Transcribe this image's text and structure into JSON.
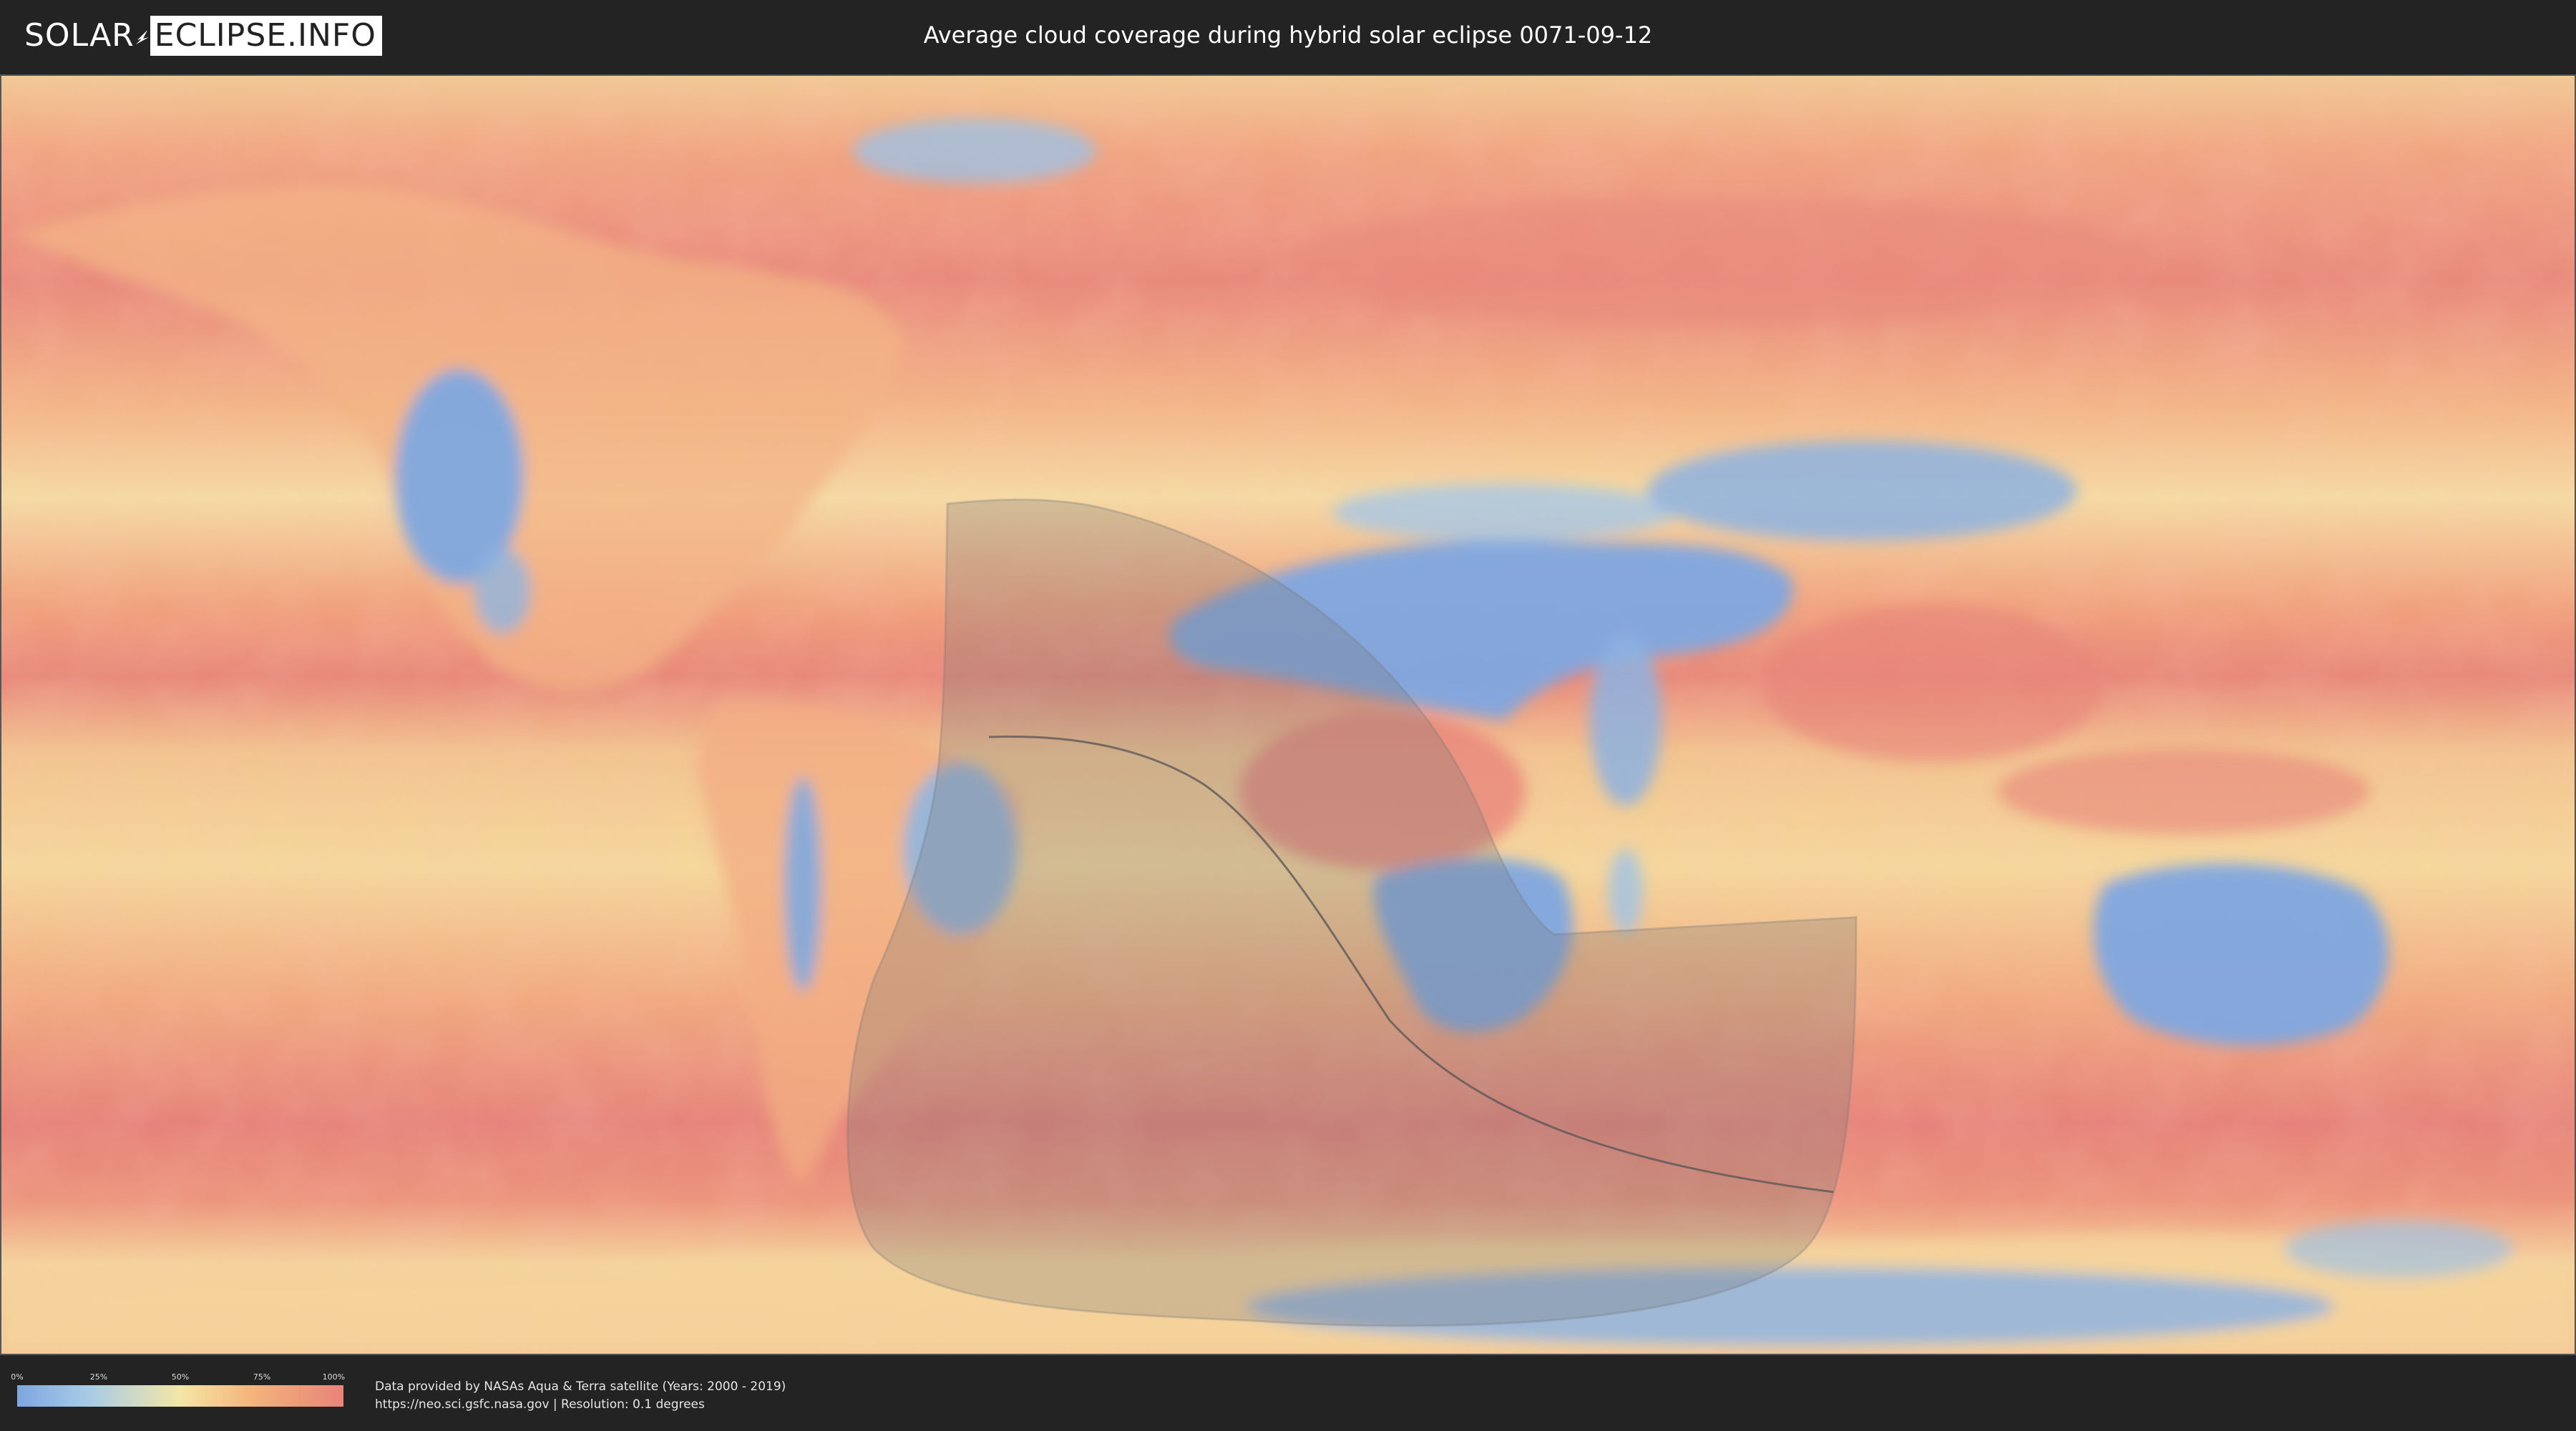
{
  "header": {
    "logo_left": "SOLAR",
    "logo_right": "ECLIPSE.INFO",
    "title": "Average cloud coverage during hybrid solar eclipse 0071-09-12"
  },
  "legend": {
    "ticks": [
      "0%",
      "25%",
      "50%",
      "75%",
      "100%"
    ],
    "colors": [
      "#7ea6e0",
      "#a8cce6",
      "#f4e6a6",
      "#f4b47a",
      "#e8837a"
    ]
  },
  "footer": {
    "line1": "Data provided by NASAs Aqua & Terra satellite (Years: 2000 - 2019)",
    "line2": "https://neo.sci.gsfc.nasa.gov | Resolution: 0.1 degrees"
  },
  "map": {
    "ocean_color": "#f0a27c",
    "cloudy_color": "#e8837a",
    "clear_color": "#7ea6e0",
    "shadow_color": "#777777",
    "central_line_color": "#555555"
  }
}
